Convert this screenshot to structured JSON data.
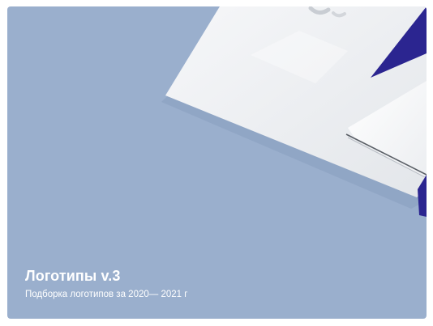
{
  "card": {
    "title": "Логотипы v.3",
    "subtitle": "Подборка логотипов за 2020— 2021 г",
    "background_color": "#9aafcd",
    "accent_color": "#2b2590",
    "cover_image": "brand-stationery-mockup"
  }
}
